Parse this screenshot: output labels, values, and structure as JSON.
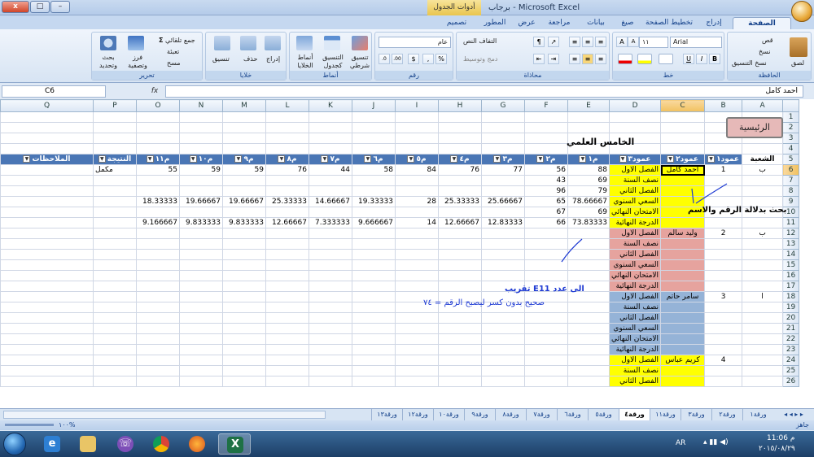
{
  "window": {
    "title": "برجاب - Microsoft Excel",
    "contextual_tab": "أدوات الجدول",
    "min_label": "–",
    "max_label": "□",
    "close_label": "x"
  },
  "ribbon_tabs": [
    "الصفحة الرئيسية",
    "إدراج",
    "تخطيط الصفحة",
    "صيغ",
    "بيانات",
    "مراجعة",
    "عرض",
    "المطور",
    "تصميم"
  ],
  "ribbon": {
    "clipboard": {
      "label": "الحافظة",
      "paste": "لصق",
      "cut": "قص",
      "copy": "نسخ",
      "format_painter": "نسخ التنسيق"
    },
    "font": {
      "label": "خط",
      "name": "Arial",
      "size": "١١",
      "bold": "B",
      "italic": "I",
      "underline": "U",
      "grow": "A",
      "shrink": "A"
    },
    "alignment": {
      "label": "محاذاة",
      "wrap": "التفاف النص",
      "merge": "دمج وتوسيط"
    },
    "number": {
      "label": "رقم",
      "format": "عام",
      "percent": "%",
      "comma": ",",
      "currency": "$"
    },
    "styles": {
      "label": "أنماط",
      "conditional": "تنسيق شرطي",
      "as_table": "التنسيق كجدول",
      "cell_styles": "أنماط الخلايا"
    },
    "cells": {
      "label": "خلايا",
      "insert": "إدراج",
      "delete": "حذف",
      "format": "تنسيق"
    },
    "editing": {
      "label": "تحرير",
      "autosum": "جمع تلقائي",
      "fill": "تعبئة",
      "clear": "مسح",
      "sort": "فرز وتصفية",
      "find": "بحث وتحديد"
    }
  },
  "formula_bar": {
    "name_box": "C6",
    "fx": "fx",
    "content": "احمد كامل"
  },
  "columns": [
    "A",
    "B",
    "C",
    "D",
    "E",
    "F",
    "G",
    "H",
    "I",
    "J",
    "K",
    "L",
    "M",
    "N",
    "O",
    "P",
    "Q"
  ],
  "header_row": {
    "A": "الشعبة",
    "B": "عمود١",
    "C": "عمود٢",
    "D": "عمود٣",
    "E": "م١",
    "F": "م٢",
    "G": "م٣",
    "H": "م٤",
    "I": "م٥",
    "J": "م٦",
    "K": "م٧",
    "L": "م٨",
    "M": "م٩",
    "N": "م١٠",
    "O": "م١١",
    "P": "النتيجة",
    "Q": "الملاحظات"
  },
  "home_button": "الرئيسية",
  "sheet_title": "الخامس العلمي",
  "student_rows": [
    {
      "row": 6,
      "A": "ب",
      "B": "1",
      "C": "احمد كامل",
      "D": "الفصل الاول",
      "E": "88",
      "F": "56",
      "G": "77",
      "H": "76",
      "I": "84",
      "J": "58",
      "K": "44",
      "L": "76",
      "M": "59",
      "N": "59",
      "O": "55",
      "P": "مكمل",
      "fill": "yel"
    },
    {
      "row": 7,
      "D": "نصف السنة",
      "E": "69",
      "F": "43",
      "fill": "yel"
    },
    {
      "row": 8,
      "D": "الفصل الثاني",
      "E": "79",
      "F": "96",
      "fill": "yel"
    },
    {
      "row": 9,
      "D": "السعي السنوي",
      "E": "78.66667",
      "F": "65",
      "G": "25.66667",
      "H": "25.33333",
      "I": "28",
      "J": "19.33333",
      "K": "14.66667",
      "L": "25.33333",
      "M": "19.66667",
      "N": "19.66667",
      "O": "18.33333",
      "fill": "yel"
    },
    {
      "row": 10,
      "D": "الامتحان النهائي",
      "E": "69",
      "F": "67",
      "fill": "yel"
    },
    {
      "row": 11,
      "D": "الدرجة النهائية",
      "E": "73.83333",
      "F": "66",
      "G": "12.83333",
      "H": "12.66667",
      "I": "14",
      "J": "9.666667",
      "K": "7.333333",
      "L": "12.66667",
      "M": "9.833333",
      "N": "9.833333",
      "O": "9.166667",
      "fill": "yel"
    },
    {
      "row": 12,
      "A": "ب",
      "B": "2",
      "C": "وليد سالم",
      "D": "الفصل الاول",
      "fill": "pink"
    },
    {
      "row": 13,
      "D": "نصف السنة",
      "fill": "pink"
    },
    {
      "row": 14,
      "D": "الفصل الثاني",
      "fill": "pink"
    },
    {
      "row": 15,
      "D": "السعي السنوي",
      "fill": "pink"
    },
    {
      "row": 16,
      "D": "الامتحان النهائي",
      "fill": "pink"
    },
    {
      "row": 17,
      "D": "الدرجة النهائية",
      "fill": "pink"
    },
    {
      "row": 18,
      "A": "ا",
      "B": "3",
      "C": "سامر حاتم",
      "D": "الفصل الاول",
      "fill": "blue"
    },
    {
      "row": 19,
      "D": "نصف السنة",
      "fill": "blue"
    },
    {
      "row": 20,
      "D": "الفصل الثاني",
      "fill": "blue"
    },
    {
      "row": 21,
      "D": "السعي السنوي",
      "fill": "blue"
    },
    {
      "row": 22,
      "D": "الامتحان النهائي",
      "fill": "blue"
    },
    {
      "row": 23,
      "D": "الدرجة النهائية",
      "fill": "blue"
    },
    {
      "row": 24,
      "B": "4",
      "C": "كريم عباس",
      "D": "الفصل الاول",
      "fill": "yel"
    },
    {
      "row": 25,
      "D": "نصف السنة",
      "fill": "yel"
    },
    {
      "row": 26,
      "D": "الفصل الثاني",
      "fill": "yel"
    }
  ],
  "annotations": {
    "search_note": "بحث بدلالة الرقم والاسم",
    "rounding_note": "الى عدد E11  تقريب",
    "rounding_note2": "صحيح  بدون كسر  ليصبح الرقم  = ٧٤"
  },
  "sheet_tabs": [
    "ورقة١",
    "ورقة٢",
    "ورقة٣",
    "ورقة١١",
    "ورقة٤",
    "ورقة٥",
    "ورقة٦",
    "ورقة٧",
    "ورقة٨",
    "ورقة٩",
    "ورقة١٠",
    "ورقة١٢",
    "ورقة١٣"
  ],
  "active_sheet": "ورقة٤",
  "status": {
    "ready": "جاهز",
    "zoom": "١٠٠%"
  },
  "tray": {
    "lang": "AR",
    "time": "11:06 م",
    "date": "٢٠١٥/٠٨/٢٩"
  },
  "colors": {
    "yellow": "#ffff00",
    "pink": "#e6a39e",
    "blue": "#95b3d7",
    "header": "#4a76b5"
  }
}
